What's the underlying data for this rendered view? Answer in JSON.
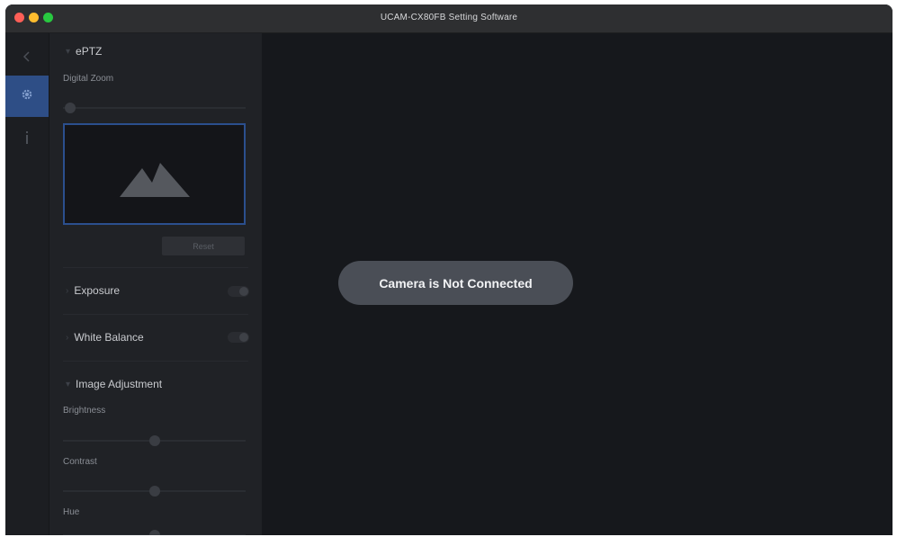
{
  "window": {
    "title": "UCAM-CX80FB Setting Software",
    "controls": {
      "close": "#ff5f57",
      "minimize": "#febc2e",
      "zoom": "#28c840"
    }
  },
  "nav_rail": {
    "items": [
      {
        "icon": "chevron-left-icon",
        "active": false
      },
      {
        "icon": "gear-icon",
        "active": true
      },
      {
        "icon": "info-icon",
        "active": false
      }
    ],
    "active_color": "#2e4e86"
  },
  "sidebar": {
    "eptz": {
      "heading": "ePTZ",
      "digital_zoom_label": "Digital Zoom",
      "digital_zoom_value": 0,
      "preview_icon": "mountain-image-icon",
      "reset_label": "Reset"
    },
    "exposure": {
      "heading": "Exposure",
      "enabled": true
    },
    "white_balance": {
      "heading": "White Balance",
      "enabled": true
    },
    "image_adjustment": {
      "heading": "Image Adjustment",
      "brightness_label": "Brightness",
      "brightness_value": 0.5,
      "contrast_label": "Contrast",
      "contrast_value": 0.5,
      "hue_label": "Hue",
      "hue_value": 0.5
    }
  },
  "main": {
    "status_message": "Camera is Not Connected"
  }
}
